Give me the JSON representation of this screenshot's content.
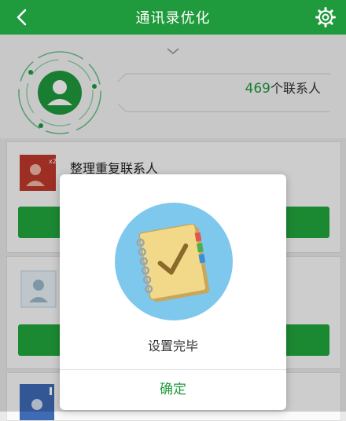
{
  "header": {
    "title": "通讯录优化",
    "back_icon": "back-arrow-icon",
    "settings_icon": "gear-icon"
  },
  "summary": {
    "count": "469",
    "count_suffix": "个联系人"
  },
  "cards": [
    {
      "title": "整理重复联系人",
      "badge": "x2"
    }
  ],
  "dialog": {
    "message": "设置完毕",
    "confirm_label": "确定"
  },
  "colors": {
    "brand_green": "#1f9a3c",
    "button_green": "#22a83e",
    "card_red": "#c0392b",
    "illus_blue": "#7ec8ee"
  }
}
